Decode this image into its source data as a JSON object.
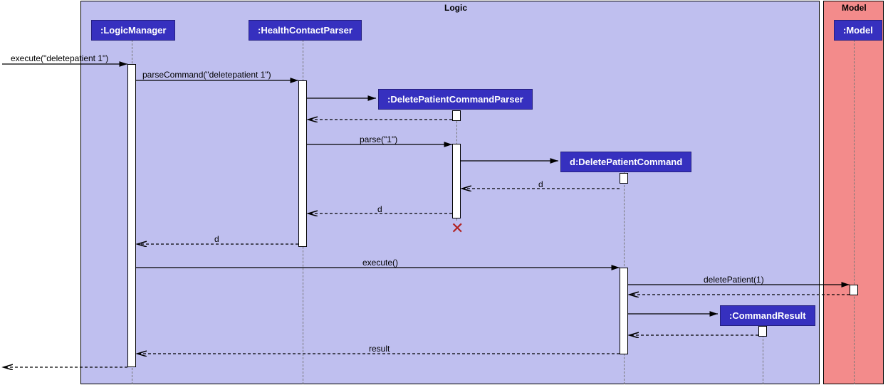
{
  "containers": {
    "logic_title": "Logic",
    "model_title": "Model"
  },
  "participants": {
    "logic_manager": ":LogicManager",
    "health_parser": ":HealthContactParser",
    "dpc_parser": ":DeletePatientCommandParser",
    "dpc": "d:DeletePatientCommand",
    "cmd_result": ":CommandResult",
    "model": ":Model"
  },
  "messages": {
    "m1": "execute(\"deletepatient 1\")",
    "m2": "parseCommand(\"deletepatient 1\")",
    "m3": "parse(\"1\")",
    "m4": "d",
    "m5": "d",
    "m6": "d",
    "m7": "execute()",
    "m8": "deletePatient(1)",
    "m9": "result"
  },
  "chart_data": {
    "type": "sequence_diagram",
    "containers": [
      {
        "name": "Logic",
        "participants": [
          "LogicManager",
          "HealthContactParser",
          "DeletePatientCommandParser",
          "DeletePatientCommand",
          "CommandResult"
        ]
      },
      {
        "name": "Model",
        "participants": [
          "Model"
        ]
      }
    ],
    "participants": [
      {
        "id": "caller",
        "name": "(external)",
        "preexisting": true
      },
      {
        "id": "logic_manager",
        "name": ":LogicManager",
        "preexisting": true
      },
      {
        "id": "health_parser",
        "name": ":HealthContactParser",
        "preexisting": true
      },
      {
        "id": "dpc_parser",
        "name": ":DeletePatientCommandParser",
        "preexisting": false
      },
      {
        "id": "dpc",
        "name": "d:DeletePatientCommand",
        "preexisting": false
      },
      {
        "id": "cmd_result",
        "name": ":CommandResult",
        "preexisting": false
      },
      {
        "id": "model",
        "name": ":Model",
        "preexisting": true
      }
    ],
    "messages": [
      {
        "from": "caller",
        "to": "logic_manager",
        "label": "execute(\"deletepatient 1\")",
        "type": "sync"
      },
      {
        "from": "logic_manager",
        "to": "health_parser",
        "label": "parseCommand(\"deletepatient 1\")",
        "type": "sync"
      },
      {
        "from": "health_parser",
        "to": "dpc_parser",
        "label": "",
        "type": "create"
      },
      {
        "from": "dpc_parser",
        "to": "health_parser",
        "label": "",
        "type": "return"
      },
      {
        "from": "health_parser",
        "to": "dpc_parser",
        "label": "parse(\"1\")",
        "type": "sync"
      },
      {
        "from": "dpc_parser",
        "to": "dpc",
        "label": "",
        "type": "create"
      },
      {
        "from": "dpc",
        "to": "dpc_parser",
        "label": "d",
        "type": "return"
      },
      {
        "from": "dpc_parser",
        "to": "health_parser",
        "label": "d",
        "type": "return"
      },
      {
        "from": "dpc_parser",
        "to": null,
        "label": "",
        "type": "destroy"
      },
      {
        "from": "health_parser",
        "to": "logic_manager",
        "label": "d",
        "type": "return"
      },
      {
        "from": "logic_manager",
        "to": "dpc",
        "label": "execute()",
        "type": "sync"
      },
      {
        "from": "dpc",
        "to": "model",
        "label": "deletePatient(1)",
        "type": "sync"
      },
      {
        "from": "model",
        "to": "dpc",
        "label": "",
        "type": "return"
      },
      {
        "from": "dpc",
        "to": "cmd_result",
        "label": "",
        "type": "create"
      },
      {
        "from": "cmd_result",
        "to": "dpc",
        "label": "",
        "type": "return"
      },
      {
        "from": "dpc",
        "to": "logic_manager",
        "label": "result",
        "type": "return"
      },
      {
        "from": "logic_manager",
        "to": "caller",
        "label": "",
        "type": "return"
      }
    ]
  }
}
